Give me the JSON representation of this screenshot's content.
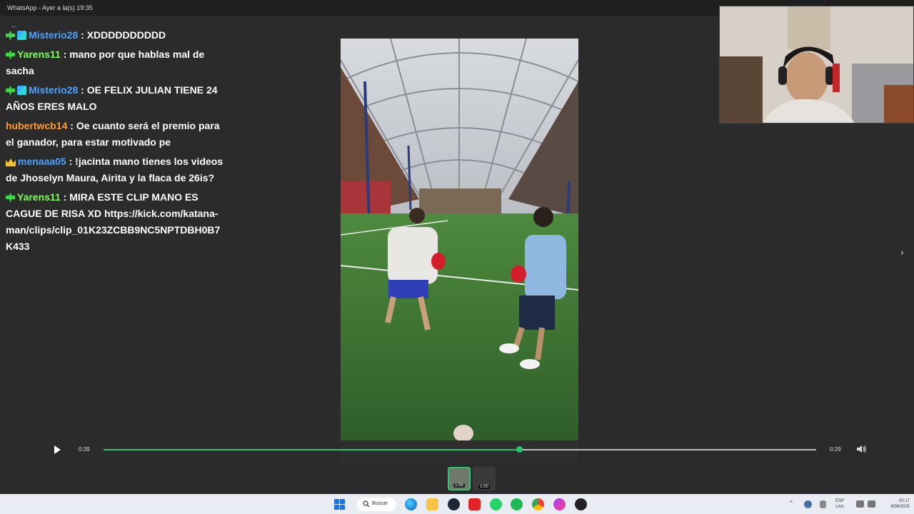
{
  "window": {
    "title": "WhatsApp - Ayer a la(s) 19:35"
  },
  "chat": {
    "messages": [
      {
        "user": "Misterio28",
        "user_color": "#4aa3ff",
        "badges": [
          "plus",
          "sub"
        ],
        "text": "XDDDDDDDDDD"
      },
      {
        "user": "Yarens11",
        "user_color": "#7cff5a",
        "badges": [
          "plus"
        ],
        "text": "mano por que hablas mal de sacha"
      },
      {
        "user": "Misterio28",
        "user_color": "#4aa3ff",
        "badges": [
          "plus",
          "sub"
        ],
        "text": "OE FELIX JULIAN TIENE 24 AÑOS ERES MALO"
      },
      {
        "user": "hubertwcb14",
        "user_color": "#ff9a2e",
        "badges": [],
        "text": "Oe cuanto será el premio para el ganador, para estar motivado pe"
      },
      {
        "user": "menaaa05",
        "user_color": "#4aa3ff",
        "badges": [
          "crown"
        ],
        "text": "!jacinta mano tienes los videos de Jhoselyn Maura, Airita y la flaca de 26is?"
      },
      {
        "user": "Yarens11",
        "user_color": "#7cff5a",
        "badges": [
          "plus"
        ],
        "text": "MIRA ESTE CLIP MANO ES CAGUE DE RISA XD https://kick.com/katana-man/clips/clip_01K23ZCBB9NC5NPTDBH0B7K433"
      }
    ],
    "separator": " : "
  },
  "player": {
    "current_time": "0:39",
    "duration": "0:29",
    "progress": 0.583,
    "accent": "#28c76f"
  },
  "thumbnails": [
    {
      "label": "1:08",
      "active": true
    },
    {
      "label": "1:00",
      "active": false
    }
  ],
  "taskbar": {
    "search_label": "Buscar",
    "lang_top": "ESP",
    "lang_bottom": "LAA",
    "time": "00:17",
    "date": "9/08/2025"
  }
}
